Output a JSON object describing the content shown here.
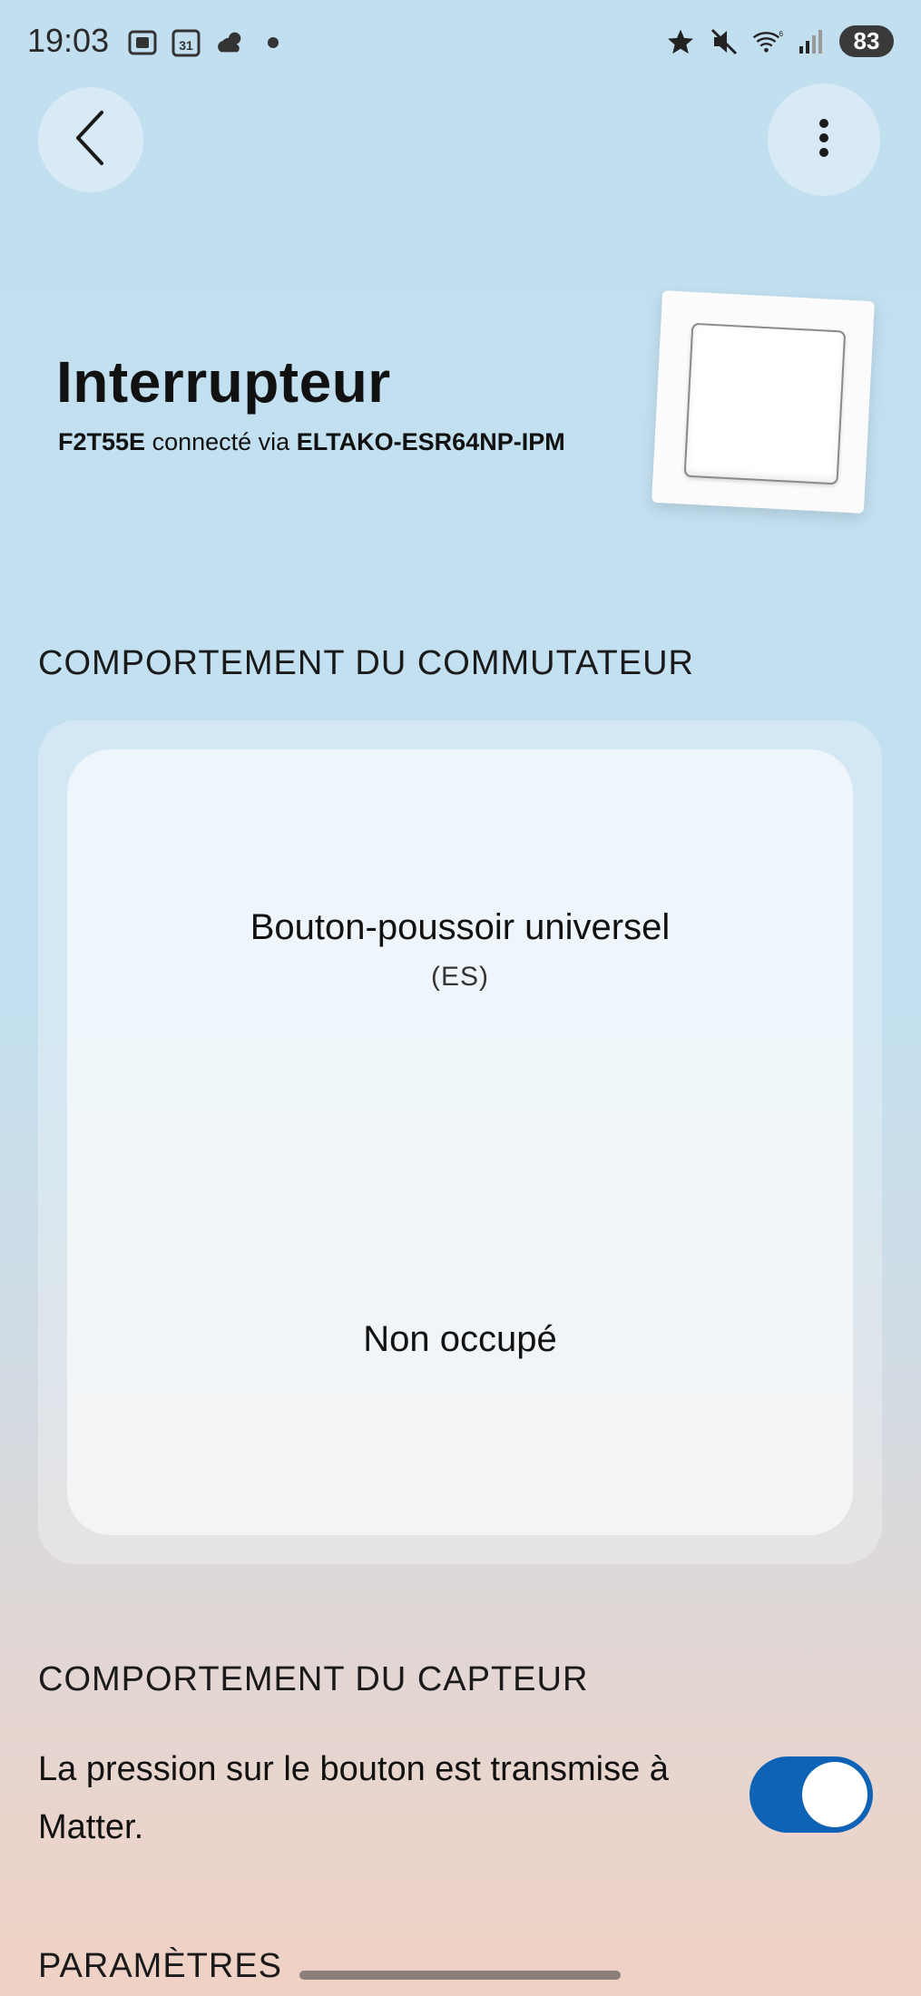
{
  "status_bar": {
    "time": "19:03",
    "calendar_day": "31",
    "wifi_label": "6",
    "battery": "83"
  },
  "header": {
    "title": "Interrupteur",
    "device_model": "F2T55E",
    "connected_via_text": "connecté via",
    "gateway": "ELTAKO-ESR64NP-IPM"
  },
  "switch_behavior": {
    "section_title": "COMPORTEMENT DU COMMUTATEUR",
    "mode_label": "Bouton-poussoir universel",
    "mode_code": "(ES)",
    "occupancy": "Non occupé"
  },
  "sensor_behavior": {
    "section_title": "COMPORTEMENT DU CAPTEUR",
    "description": "La pression sur le bouton est transmise à Matter.",
    "toggle_on": true
  },
  "settings": {
    "section_title": "PARAMÈTRES"
  },
  "colors": {
    "accent": "#0f63b6",
    "background_top": "#c2dff0",
    "background_bottom": "#f0d2c4"
  }
}
